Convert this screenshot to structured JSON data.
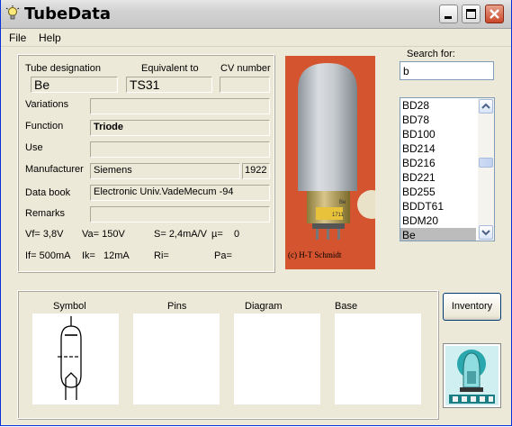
{
  "window": {
    "title": "TubeData"
  },
  "menu": {
    "file": "File",
    "help": "Help"
  },
  "headers": {
    "designation": "Tube designation",
    "equivalent": "Equivalent to",
    "cv": "CV number"
  },
  "tube": {
    "designation": "Be",
    "equivalent": "TS31",
    "cv_number": "",
    "variations": "",
    "function": "Triode",
    "use": "",
    "manufacturer": "Siemens",
    "year": "1922",
    "data_book": "Electronic Univ.VadeMecum -94",
    "remarks": ""
  },
  "labels": {
    "variations": "Variations",
    "function": "Function",
    "use": "Use",
    "manufacturer": "Manufacturer",
    "data_book": "Data book",
    "remarks": "Remarks"
  },
  "params": {
    "vf": "Vf= 3,8V",
    "va": "Va= 150V",
    "s": "S= 2,4mA/V",
    "mu": "µ=",
    "mu_val": "0",
    "if": "If= 500mA",
    "ik": "Ik=",
    "ik_val": "12mA",
    "ri": "Ri=",
    "pa": "Pa="
  },
  "photo": {
    "credit": "(c) H-T Schmidt",
    "print_1": "Be",
    "print_2": "1711"
  },
  "search": {
    "label": "Search for:",
    "value": "b"
  },
  "list": {
    "items": [
      "BD28",
      "BD78",
      "BD100",
      "BD214",
      "BD216",
      "BD221",
      "BD255",
      "BDDT61",
      "BDM20",
      "Be"
    ],
    "selected": "Be"
  },
  "sections": {
    "symbol": "Symbol",
    "pins": "Pins",
    "diagram": "Diagram",
    "base": "Base"
  },
  "buttons": {
    "inventory": "Inventory"
  },
  "colors": {
    "photo_bg": "#d4542f",
    "title_bar": "#d2d2d2",
    "close_button": "#c9472a",
    "window_bg": "#ece9d8"
  }
}
